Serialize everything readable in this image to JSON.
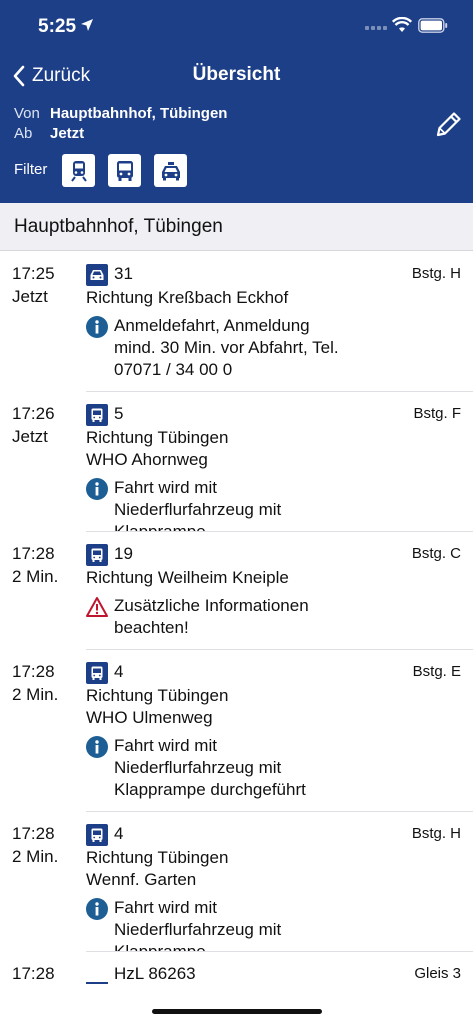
{
  "status": {
    "time": "5:25"
  },
  "nav": {
    "back_label": "Zurück",
    "title": "Übersicht"
  },
  "query": {
    "from_label": "Von",
    "from_value": "Hauptbahnhof, Tübingen",
    "when_label": "Ab",
    "when_value": "Jetzt",
    "filter_label": "Filter"
  },
  "filters": [
    "train-icon",
    "bus-icon",
    "taxi-icon"
  ],
  "station": "Hauptbahnhof, Tübingen",
  "departures": [
    {
      "time": "17:25",
      "sub": "Jetzt",
      "icon": "taxi-icon",
      "line": "31",
      "platform": "Bstg. H",
      "directions": [
        "Richtung Kreßbach Eckhof"
      ],
      "note": {
        "type": "info",
        "text": "Anmeldefahrt, Anmeldung mind. 30 Min. vor Abfahrt, Tel. 07071 / 34 00 0"
      }
    },
    {
      "time": "17:26",
      "sub": "Jetzt",
      "icon": "bus-icon",
      "line": "5",
      "platform": "Bstg. F",
      "directions": [
        "Richtung Tübingen",
        "WHO Ahornweg"
      ],
      "note": {
        "type": "info",
        "text": "Fahrt wird mit Niederflurfahrzeug mit Klapprampe"
      }
    },
    {
      "time": "17:28",
      "sub": "2 Min.",
      "icon": "bus-icon",
      "line": "19",
      "platform": "Bstg. C",
      "directions": [
        "Richtung Weilheim Kneiple"
      ],
      "note": {
        "type": "warning",
        "text": "Zusätzliche Informationen beachten!"
      }
    },
    {
      "time": "17:28",
      "sub": "2 Min.",
      "icon": "bus-icon",
      "line": "4",
      "platform": "Bstg. E",
      "directions": [
        "Richtung Tübingen",
        "WHO Ulmenweg"
      ],
      "note": {
        "type": "info",
        "text": "Fahrt wird mit Niederflurfahrzeug mit Klapprampe durchgeführt"
      }
    },
    {
      "time": "17:28",
      "sub": "2 Min.",
      "icon": "bus-icon",
      "line": "4",
      "platform": "Bstg. H",
      "directions": [
        "Richtung Tübingen",
        "Wennf. Garten"
      ],
      "note": {
        "type": "info",
        "text": "Fahrt wird mit Niederflurfahrzeug mit Klapprampe"
      }
    },
    {
      "time": "17:28",
      "sub": "",
      "icon": "train-icon",
      "line": "HzL 86263",
      "platform": "Gleis 3",
      "directions": [],
      "note": null
    }
  ],
  "colors": {
    "brand": "#1d3f87",
    "info": "#1d5f94",
    "warning": "#c0152f"
  }
}
